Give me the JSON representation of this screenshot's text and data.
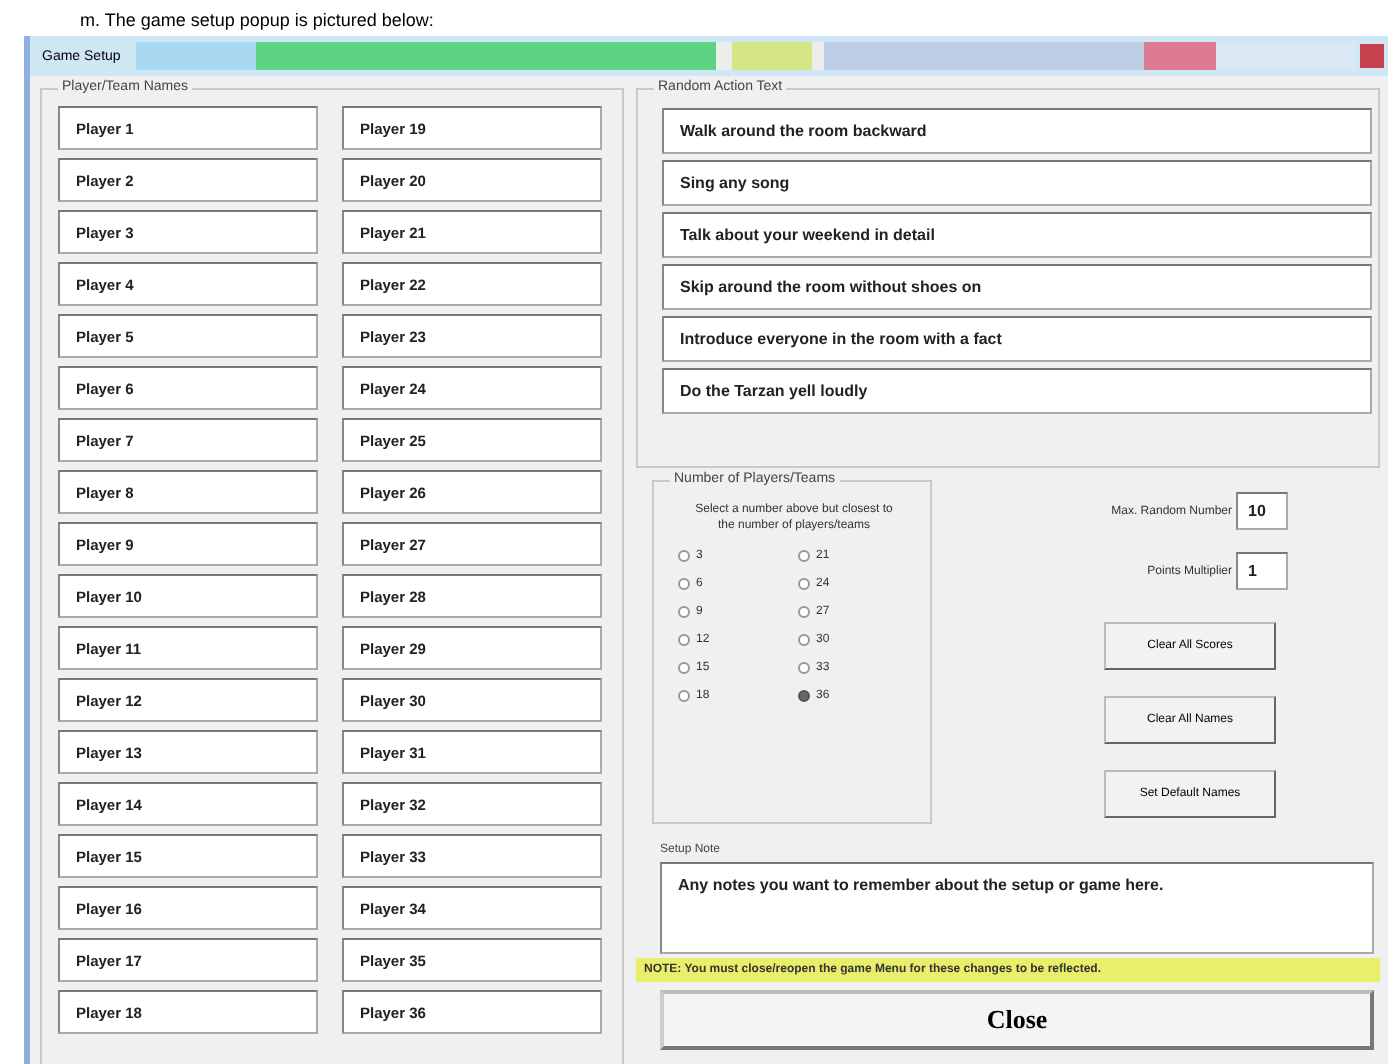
{
  "caption": "m.  The game setup popup is pictured below:",
  "window": {
    "title": "Game Setup"
  },
  "player_names": {
    "label": "Player/Team Names",
    "columns": [
      [
        "Player 1",
        "Player 2",
        "Player 3",
        "Player 4",
        "Player 5",
        "Player 6",
        "Player 7",
        "Player 8",
        "Player 9",
        "Player 10",
        "Player 11",
        "Player 12",
        "Player 13",
        "Player 14",
        "Player 15",
        "Player 16",
        "Player 17",
        "Player 18"
      ],
      [
        "Player 19",
        "Player 20",
        "Player 21",
        "Player 22",
        "Player 23",
        "Player 24",
        "Player 25",
        "Player 26",
        "Player 27",
        "Player 28",
        "Player 29",
        "Player 30",
        "Player 31",
        "Player 32",
        "Player 33",
        "Player 34",
        "Player 35",
        "Player 36"
      ]
    ]
  },
  "random_action_text": {
    "label": "Random Action Text",
    "items": [
      "Walk around the room backward",
      "Sing any song",
      "Talk about your weekend in detail",
      "Skip around the room without shoes on",
      "Introduce everyone in the room with a fact",
      "Do the Tarzan yell loudly"
    ]
  },
  "players_count": {
    "label": "Number of Players/Teams",
    "hint": "Select a number above but closest to the number of players/teams",
    "options": [
      {
        "label": "3",
        "selected": false
      },
      {
        "label": "6",
        "selected": false
      },
      {
        "label": "9",
        "selected": false
      },
      {
        "label": "12",
        "selected": false
      },
      {
        "label": "15",
        "selected": false
      },
      {
        "label": "18",
        "selected": false
      },
      {
        "label": "21",
        "selected": false
      },
      {
        "label": "24",
        "selected": false
      },
      {
        "label": "27",
        "selected": false
      },
      {
        "label": "30",
        "selected": false
      },
      {
        "label": "33",
        "selected": false
      },
      {
        "label": "36",
        "selected": true
      }
    ]
  },
  "settings": [
    {
      "label": "Max. Random Number",
      "value": "10"
    },
    {
      "label": "Points Multiplier",
      "value": "1"
    }
  ],
  "buttons": [
    "Clear All Scores",
    "Clear All Names",
    "Set Default Names"
  ],
  "setup_note": {
    "label": "Setup Note",
    "value": "Any notes you want to remember about the setup or game here."
  },
  "notice": "NOTE: You must close/reopen the game Menu for these changes to be reflected.",
  "close_button": "Close"
}
